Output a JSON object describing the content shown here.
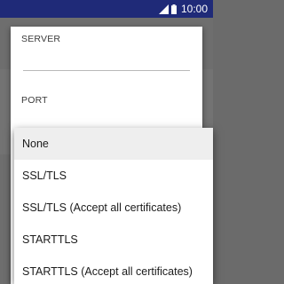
{
  "status_bar": {
    "time": "10:00",
    "signal_icon": "cellular-signal-icon",
    "battery_icon": "battery-icon"
  },
  "dialog": {
    "server_label": "SERVER",
    "server_value": "",
    "port_label": "PORT"
  },
  "security_menu": {
    "selected": "None",
    "options": [
      "None",
      "SSL/TLS",
      "SSL/TLS (Accept all certificates)",
      "STARTTLS",
      "STARTTLS (Accept all certificates)"
    ]
  },
  "colors": {
    "status_bar": "#1f2a78",
    "scrim": "#6b6b6b",
    "selected_item": "#eeeeee"
  }
}
